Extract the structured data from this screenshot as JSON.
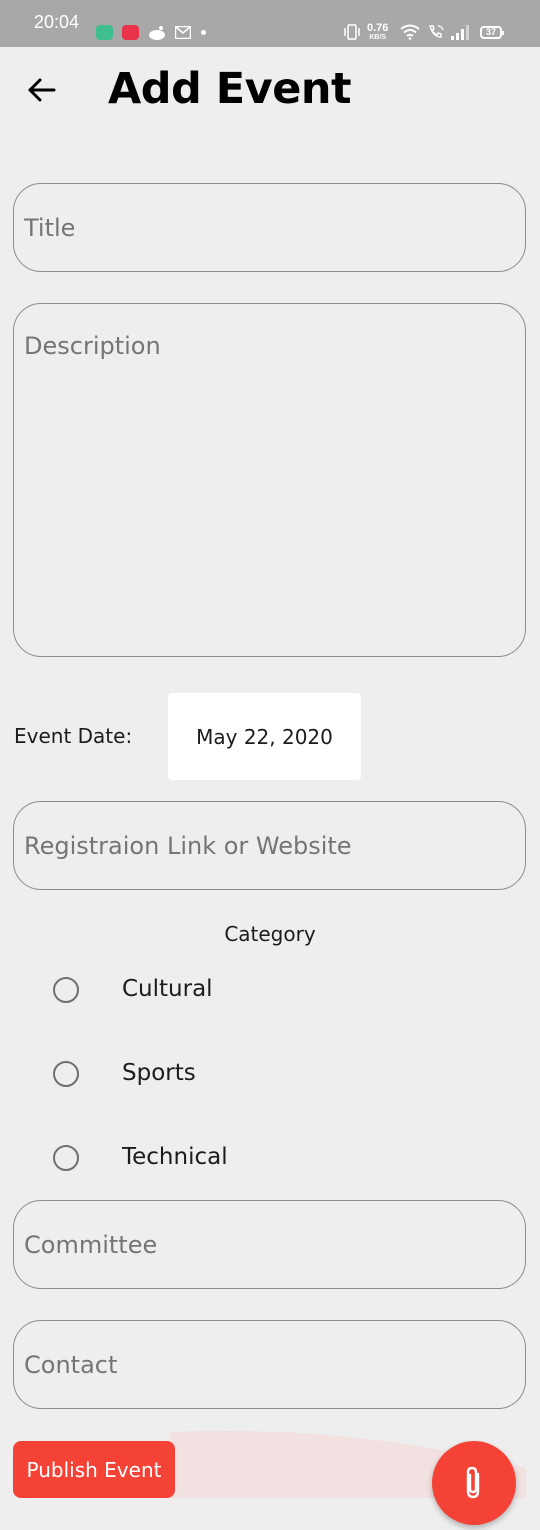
{
  "status_bar": {
    "time": "20:04",
    "net_speed_value": "0.76",
    "net_speed_unit": "KB/S",
    "battery_level": "37",
    "notification_icons": [
      "chat-icon",
      "video-icon",
      "reddit-icon",
      "gmail-icon",
      "dot-icon"
    ],
    "system_icons": [
      "vibrate-icon",
      "wifi-icon",
      "wifi-call-icon",
      "signal-icon",
      "battery-icon"
    ]
  },
  "header": {
    "back_icon": "arrow-left-icon",
    "title": "Add Event"
  },
  "form": {
    "title_placeholder": "Title",
    "description_placeholder": "Description",
    "event_date_label": "Event Date:",
    "event_date_value": "May 22, 2020",
    "link_placeholder": "Registraion Link or Website",
    "category_label": "Category",
    "categories": [
      "Cultural",
      "Sports",
      "Technical"
    ],
    "selected_category": null,
    "committee_placeholder": "Committee",
    "contact_placeholder": "Contact"
  },
  "actions": {
    "publish_label": "Publish Event",
    "attach_icon": "paperclip-icon"
  },
  "colors": {
    "accent": "#f44336",
    "background": "#eeeeee",
    "status_bar": "#a8a8a8",
    "field_border": "#8c8c8c",
    "placeholder": "#757575"
  }
}
